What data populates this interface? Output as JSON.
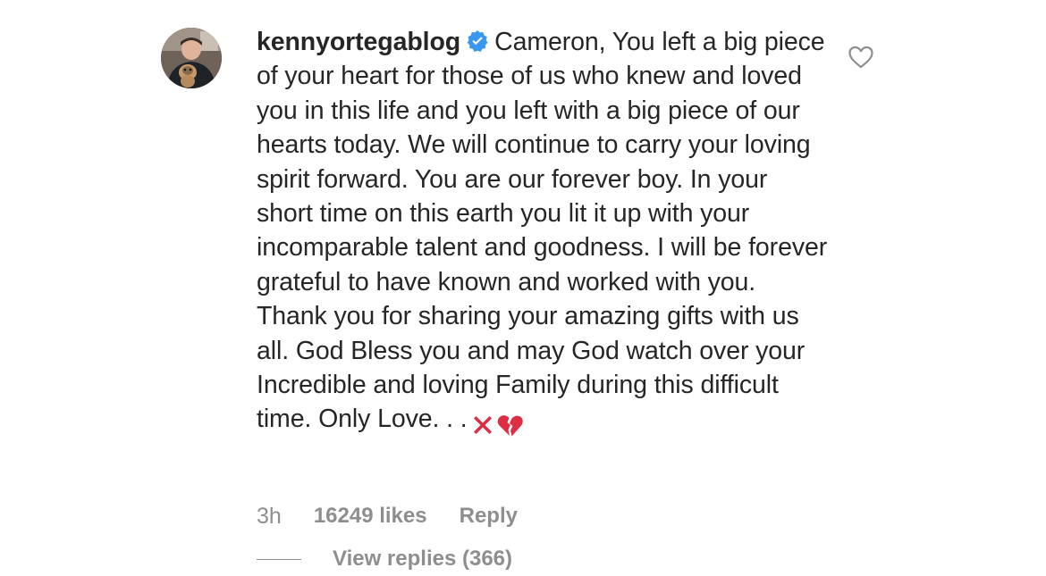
{
  "comment": {
    "username": "kennyortegablog",
    "verified": true,
    "text": "Cameron, You left a big piece of your heart for those of us who knew and loved you in this life and you left with a big piece of our hearts today. We will continue to carry your loving spirit forward. You are our forever boy. In your short time on this earth you lit it up with your incomparable talent and goodness. I will be forever grateful to have known and worked with you. Thank you for sharing your amazing gifts with us all. God Bless you and may God watch over your Incredible and loving Family during this difficult time. Only Love. . .",
    "emojis": [
      "cross-mark-emoji",
      "broken-heart-emoji"
    ],
    "time": "3h",
    "likes": "16249 likes",
    "reply_label": "Reply",
    "view_replies_label": "View replies (366)"
  },
  "colors": {
    "text": "#262626",
    "secondary": "#8e8e8e",
    "verified_blue": "#3897f0",
    "emoji_red": "#dd2e44"
  },
  "icons": {
    "verified": "verified-badge-icon",
    "like": "heart-outline-icon"
  }
}
